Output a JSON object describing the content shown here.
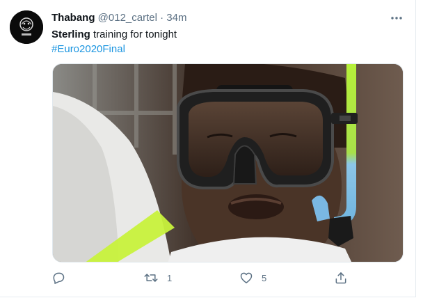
{
  "tweet": {
    "author_name": "Thabang",
    "handle": "@012_cartel",
    "separator": "·",
    "time": "34m",
    "text_bold": "Sterling",
    "text_rest": " training for tonight",
    "hashtag": "#Euro2020Final",
    "more_icon": "more-horizontal-icon"
  },
  "actions": {
    "reply_icon": "reply-icon",
    "retweet_icon": "retweet-icon",
    "retweet_count": "1",
    "like_icon": "heart-icon",
    "like_count": "5",
    "share_icon": "share-icon"
  },
  "colors": {
    "link": "#1b95e0",
    "secondary_text": "#5b7083",
    "primary_text": "#0f1419"
  }
}
